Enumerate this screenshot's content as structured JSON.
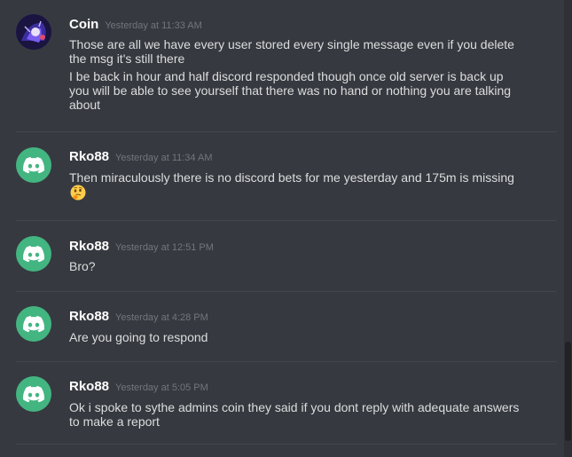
{
  "messages": [
    {
      "author": "Coin",
      "timestamp": "Yesterday at 11:33 AM",
      "avatar_icon": "coin-avatar",
      "lines": [
        "Those are all we have every user stored every single message even if you delete the msg it's still there",
        "I be back in hour and half discord responded though once old server is back up you will be able to see yourself that there was no hand or nothing you are talking about"
      ]
    },
    {
      "author": "Rko88",
      "timestamp": "Yesterday at 11:34 AM",
      "avatar_icon": "discord-logo-icon",
      "lines": [
        "Then miraculously there is no discord bets for me yesterday and 175m is missing"
      ],
      "emoji": "thinking-face-emoji"
    },
    {
      "author": "Rko88",
      "timestamp": "Yesterday at 12:51 PM",
      "avatar_icon": "discord-logo-icon",
      "lines": [
        "Bro?"
      ]
    },
    {
      "author": "Rko88",
      "timestamp": "Yesterday at 4:28 PM",
      "avatar_icon": "discord-logo-icon",
      "lines": [
        "Are you going to respond"
      ]
    },
    {
      "author": "Rko88",
      "timestamp": "Yesterday at 5:05 PM",
      "avatar_icon": "discord-logo-icon",
      "lines": [
        "Ok i spoke to sythe admins coin they said if you dont reply with adequate answers to make a report"
      ]
    }
  ],
  "colors": {
    "background": "#36393f",
    "username": "#ffffff",
    "text": "#dcddde",
    "timestamp": "#72767d",
    "discord_avatar": "#43b581"
  }
}
